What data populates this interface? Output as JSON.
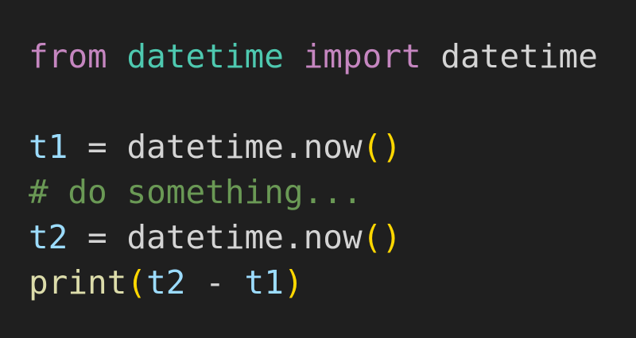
{
  "editor": {
    "background": "#1f1f1f",
    "lines": {
      "line1": {
        "kw_from": "from",
        "module": "datetime",
        "kw_import": "import",
        "name": "datetime"
      },
      "line2": {},
      "line3": {
        "var": "t1",
        "assign": " = ",
        "call": "datetime.now",
        "parens": "()"
      },
      "line4": {
        "comment": "# do something..."
      },
      "line5": {
        "var": "t2",
        "assign": " = ",
        "call": "datetime.now",
        "parens": "()"
      },
      "line6": {
        "func": "print",
        "open_paren": "(",
        "arg1": "t2",
        "minus": " - ",
        "arg2": "t1",
        "close_paren": ")"
      }
    },
    "colors": {
      "keyword": "#c586c0",
      "module": "#4ec9b0",
      "plain": "#d4d4d4",
      "variable": "#9cdcfe",
      "paren": "#ffd700",
      "comment": "#6a9955",
      "function": "#dcdcaa"
    }
  }
}
